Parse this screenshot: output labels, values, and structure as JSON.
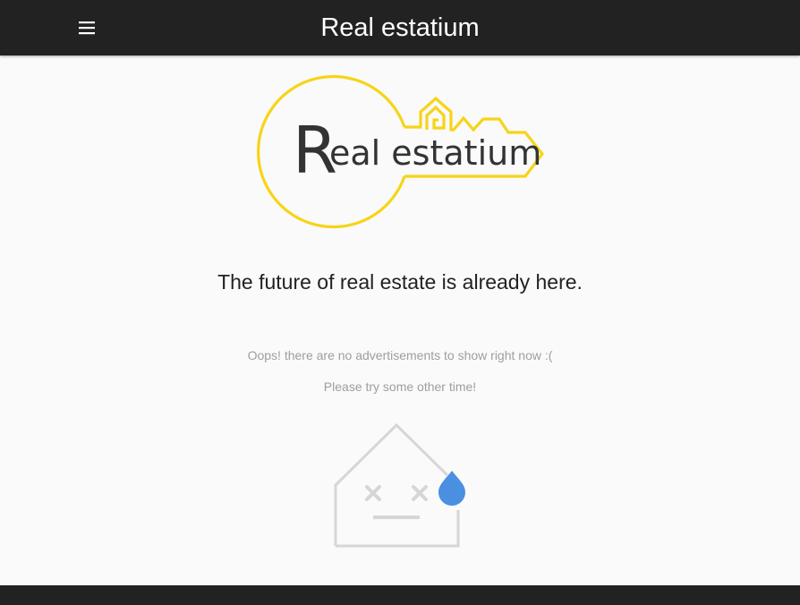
{
  "header": {
    "title": "Real estatium",
    "menu_icon": "hamburger-menu-icon"
  },
  "logo": {
    "initial": "R",
    "rest": "eal estatium",
    "accent_color": "#f7d417",
    "text_color": "#333333"
  },
  "main": {
    "tagline": "The future of real estate is already here.",
    "empty_state": {
      "message": "Oops! there are no advertisements to show right now :(",
      "hint": "Please try some other time!",
      "icon": "sad-house-icon",
      "drop_color": "#4a8fe0"
    }
  },
  "colors": {
    "header_bg": "#222222",
    "page_bg": "#fafafa"
  }
}
